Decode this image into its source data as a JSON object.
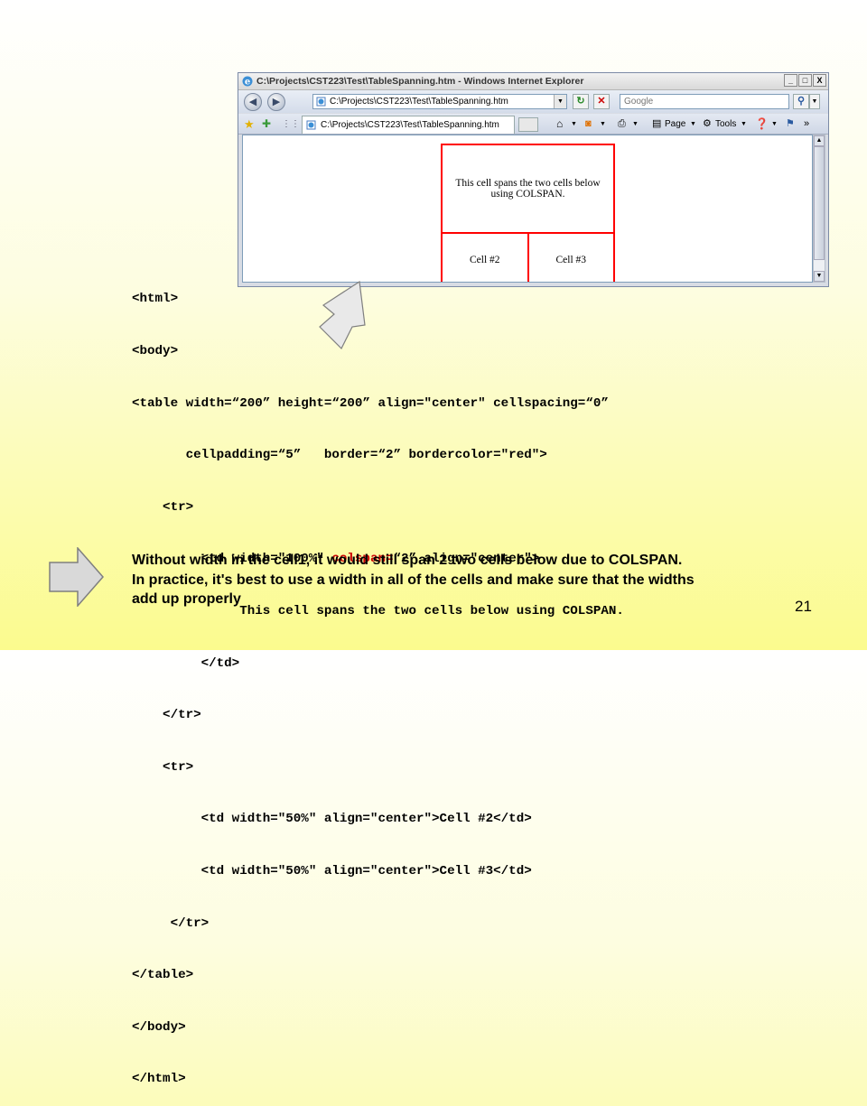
{
  "browser": {
    "title": "C:\\Projects\\CST223\\Test\\TableSpanning.htm - Windows Internet Explorer",
    "address": "C:\\Projects\\CST223\\Test\\TableSpanning.htm",
    "search_placeholder": "Google",
    "tab_title": "C:\\Projects\\CST223\\Test\\TableSpanning.htm",
    "commands": {
      "page": "Page",
      "tools": "Tools"
    },
    "window_buttons": {
      "minimize": "_",
      "maximize": "□",
      "close": "X"
    }
  },
  "demo_table": {
    "row1": "This cell spans the two cells below using COLSPAN.",
    "cell2": "Cell #2",
    "cell3": "Cell #3"
  },
  "code_lines": [
    "<html>",
    "<body>",
    "<table width=“200” height=“200” align=\"center\" cellspacing=“0”",
    "       cellpadding=“5”   border=“2” bordercolor=\"red\">",
    "    <tr>",
    "         <td width=\"100%\" ",
    "              This cell spans the two cells below using COLSPAN.",
    "         </td>",
    "    </tr>",
    "    <tr>",
    "         <td width=\"50%\" align=\"center\">Cell #2</td>",
    "         <td width=\"50%\" align=\"center\">Cell #3</td>",
    "     </tr>",
    "</table>",
    "</body>",
    "</html>"
  ],
  "code_highlight": "colspan=",
  "code_line6_rest": "“2” align=\"center\">",
  "note_lines": [
    "Without width in the cell1, it would still span 2 two cells below due to COLSPAN.",
    "In practice, it's best to use a width in all of the cells and make sure that the widths",
    "add up properly"
  ],
  "page_number": "21",
  "colors": {
    "highlight": "#cc0000",
    "table_border": "#ff0000",
    "arrow_fill": "#d9d9d9",
    "arrow_stroke": "#7f7f7f"
  }
}
